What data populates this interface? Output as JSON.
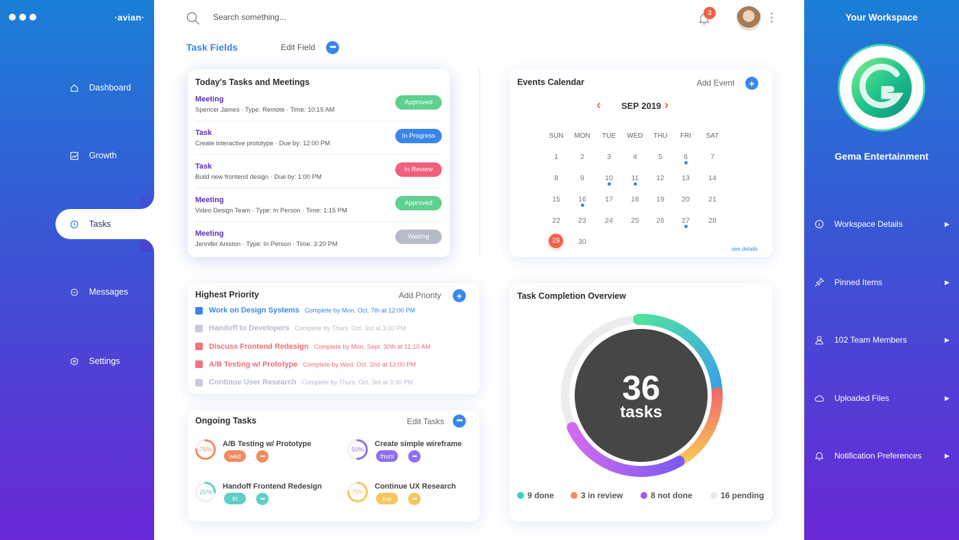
{
  "app": {
    "brand": "·avian·"
  },
  "nav": [
    {
      "label": "Dashboard",
      "icon": "home-icon"
    },
    {
      "label": "Growth",
      "icon": "chart-icon"
    },
    {
      "label": "Tasks",
      "icon": "timer-icon",
      "active": true
    },
    {
      "label": "Messages",
      "icon": "chat-icon"
    },
    {
      "label": "Settings",
      "icon": "shield-icon"
    }
  ],
  "topbar": {
    "search_placeholder": "Search something...",
    "notifications": "3"
  },
  "task_fields": {
    "title": "Task Fields",
    "edit_label": "Edit Field"
  },
  "today": {
    "title": "Today's Tasks and Meetings",
    "items": [
      {
        "type": "Meeting",
        "detail": "Spencer James · Type: Remote · Time: 10:15 AM",
        "status": "Approved",
        "color": "#5fd08f"
      },
      {
        "type": "Task",
        "detail": "Create interactive prototype · Due by: 12:00 PM",
        "status": "In Progress",
        "color": "#3a86e8"
      },
      {
        "type": "Task",
        "detail": "Build new frontend design · Due by: 1:00 PM",
        "status": "In Review",
        "color": "#f0607c"
      },
      {
        "type": "Meeting",
        "detail": "Video Design Team · Type: In Person · Time: 1:15 PM",
        "status": "Approved",
        "color": "#5fd08f"
      },
      {
        "type": "Meeting",
        "detail": "Jennifer Aniston · Type: In Person · Time: 3:20 PM",
        "status": "Waiting",
        "color": "#b7bbc8"
      }
    ]
  },
  "calendar": {
    "title": "Events Calendar",
    "add_label": "Add Event",
    "month": "SEP 2019",
    "dow": [
      "SUN",
      "MON",
      "TUE",
      "WED",
      "THU",
      "FRI",
      "SAT"
    ],
    "days": [
      "1",
      "2",
      "3",
      "4",
      "5",
      "6",
      "7",
      "8",
      "9",
      "10",
      "11",
      "12",
      "13",
      "14",
      "15",
      "16",
      "17",
      "18",
      "19",
      "20",
      "21",
      "22",
      "23",
      "24",
      "25",
      "26",
      "27",
      "28",
      "29",
      "30"
    ],
    "event_days": [
      6,
      10,
      11,
      16,
      27
    ],
    "today": "29",
    "see_details": "see details"
  },
  "priority": {
    "title": "Highest Priority",
    "add_label": "Add Priority",
    "items": [
      {
        "name": "Work on Design Systems",
        "sub": "Complete by Mon. Oct. 7th at 12:00 PM",
        "color": "#3a86e8",
        "textColor": "#3a86e8"
      },
      {
        "name": "Handoff to Developers",
        "sub": "Complete by Thurs. Oct. 3rd at 3:20 PM",
        "color": "#c6cbd6",
        "textColor": "#b6bccb"
      },
      {
        "name": "Discuss Frontend Redesign",
        "sub": "Complete by Mon. Sept. 30th at 11:10 AM",
        "color": "#f0737e",
        "textColor": "#ef6d74"
      },
      {
        "name": "A/B Testing w/ Prototype",
        "sub": "Complete by Wed. Oct. 2nd at 12:00 PM",
        "color": "#f0737e",
        "textColor": "#ef6d74"
      },
      {
        "name": "Continue User Research",
        "sub": "Complete by Thurs. Oct. 3rd at 3:30 PM",
        "color": "#c6cbd6",
        "textColor": "#b6bccb"
      }
    ]
  },
  "ongoing": {
    "title": "Ongoing Tasks",
    "edit_label": "Edit Tasks",
    "items": [
      {
        "name": "A/B Testing w/ Prototype",
        "percent": "75%",
        "progress": 0.75,
        "tag": "wed",
        "color": "#f48a60"
      },
      {
        "name": "Create simple wireframe",
        "percent": "50%",
        "progress": 0.5,
        "tag": "thurs",
        "color": "#8f6ff0"
      },
      {
        "name": "Handoff Frontend Redesign",
        "percent": "25%",
        "progress": 0.25,
        "tag": "fri",
        "color": "#5ccfc6"
      },
      {
        "name": "Continue UX Research",
        "percent": "75%",
        "progress": 0.75,
        "tag": "tue",
        "color": "#f6c55b"
      }
    ]
  },
  "completion": {
    "title": "Task Completion Overview",
    "total": "36",
    "unit": "tasks",
    "legend": [
      {
        "label": "9 done",
        "color": "#36d3c2"
      },
      {
        "label": "3 in review",
        "color": "#f48a5a"
      },
      {
        "label": "8 not done",
        "color": "#a858f0"
      },
      {
        "label": "16 pending",
        "color": "#e8e8ec"
      }
    ]
  },
  "workspace": {
    "title": "Your Workspace",
    "company": "Gema Entertainment",
    "items": [
      {
        "label": "Workspace Details",
        "icon": "info-icon"
      },
      {
        "label": "Pinned Items",
        "icon": "pin-icon"
      },
      {
        "label": "102 Team Members",
        "icon": "user-icon"
      },
      {
        "label": "Uploaded Files",
        "icon": "cloud-icon"
      },
      {
        "label": "Notification Preferences",
        "icon": "bell-icon"
      }
    ]
  }
}
